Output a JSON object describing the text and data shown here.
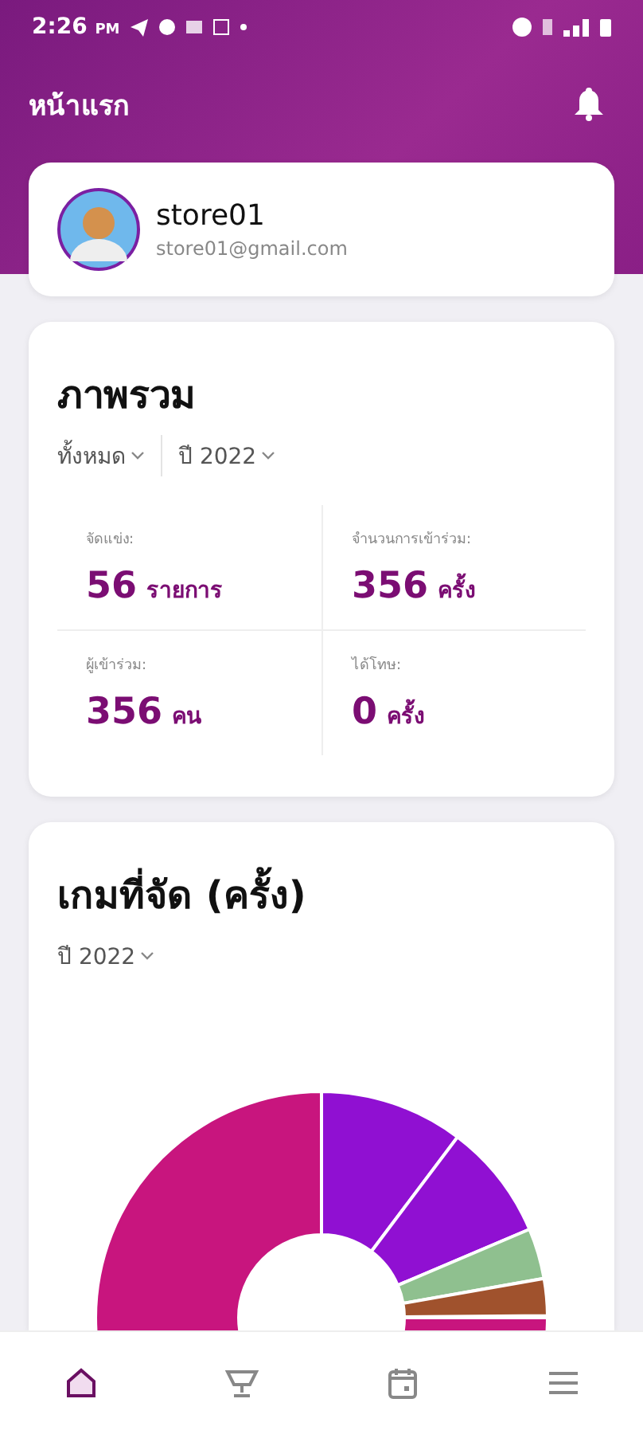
{
  "status_bar": {
    "time": "2:26",
    "meridiem": "PM"
  },
  "header": {
    "title": "หน้าแรก"
  },
  "profile": {
    "name": "store01",
    "email": "store01@gmail.com"
  },
  "overview": {
    "title": "ภาพรวม",
    "filters": [
      {
        "label": "ทั้งหมด"
      },
      {
        "label": "ปี 2022"
      }
    ],
    "stats": [
      {
        "label": "จัดแข่ง:",
        "value": "56",
        "unit": "รายการ"
      },
      {
        "label": "จำนวนการเข้าร่วม:",
        "value": "356",
        "unit": "ครั้ง"
      },
      {
        "label": "ผู้เข้าร่วม:",
        "value": "356",
        "unit": "คน"
      },
      {
        "label": "ได้โทษ:",
        "value": "0",
        "unit": "ครั้ง"
      }
    ]
  },
  "games": {
    "title": "เกมที่จัด (ครั้ง)",
    "filter": "ปี 2022"
  },
  "nav": [
    {
      "kind": "home",
      "selected": true
    },
    {
      "kind": "trophy",
      "selected": false
    },
    {
      "kind": "calendar",
      "selected": false
    },
    {
      "kind": "menu",
      "selected": false
    }
  ]
}
